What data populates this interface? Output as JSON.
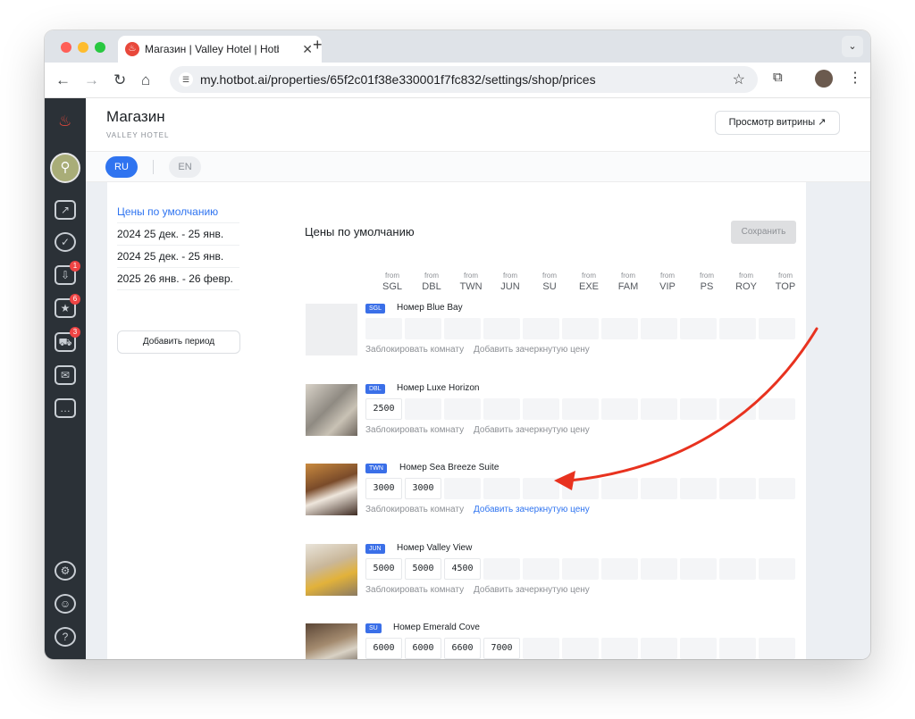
{
  "browser": {
    "tab_title": "Магазин | Valley Hotel | Hotbot",
    "url": "my.hotbot.ai/properties/65f2c01f38e330001f7fc832/settings/shop/prices"
  },
  "sidebar": {
    "badges": {
      "inbox": "1",
      "reviews": "6",
      "cart": "3"
    }
  },
  "header": {
    "title": "Магазин",
    "subtitle": "VALLEY HOTEL",
    "preview_button": "Просмотр витрины ↗"
  },
  "languages": {
    "active": "RU",
    "other": "EN"
  },
  "periods": {
    "items": [
      "Цены по умолчанию",
      "2024 25 дек. - 25 янв.",
      "2024 25 дек. - 25 янв.",
      "2025 26 янв. - 26 февр."
    ],
    "add_button": "Добавить период"
  },
  "prices": {
    "title": "Цены по умолчанию",
    "save_button": "Сохранить",
    "from_label": "from",
    "columns": [
      "SGL",
      "DBL",
      "TWN",
      "JUN",
      "SU",
      "EXE",
      "FAM",
      "VIP",
      "PS",
      "ROY",
      "TOP"
    ],
    "block_room_label": "Заблокировать комнату",
    "add_strike_price_label": "Добавить зачеркнутую цену",
    "rooms": [
      {
        "tag": "SGL",
        "name": "Номер Blue Bay",
        "prices": [
          "",
          "",
          "",
          "",
          "",
          "",
          "",
          "",
          "",
          "",
          ""
        ]
      },
      {
        "tag": "DBL",
        "name": "Номер Luxe Horizon",
        "prices": [
          "2500",
          "",
          "",
          "",
          "",
          "",
          "",
          "",
          "",
          "",
          ""
        ]
      },
      {
        "tag": "TWN",
        "name": "Номер Sea Breeze Suite",
        "prices": [
          "3000",
          "3000",
          "",
          "",
          "",
          "",
          "",
          "",
          "",
          "",
          ""
        ]
      },
      {
        "tag": "JUN",
        "name": "Номер Valley View",
        "prices": [
          "5000",
          "5000",
          "4500",
          "",
          "",
          "",
          "",
          "",
          "",
          "",
          ""
        ]
      },
      {
        "tag": "SU",
        "name": "Номер Emerald Cove",
        "prices": [
          "6000",
          "6000",
          "6600",
          "7000",
          "",
          "",
          "",
          "",
          "",
          "",
          ""
        ]
      }
    ]
  },
  "annotation": {
    "arrow_color": "#e8321f"
  }
}
